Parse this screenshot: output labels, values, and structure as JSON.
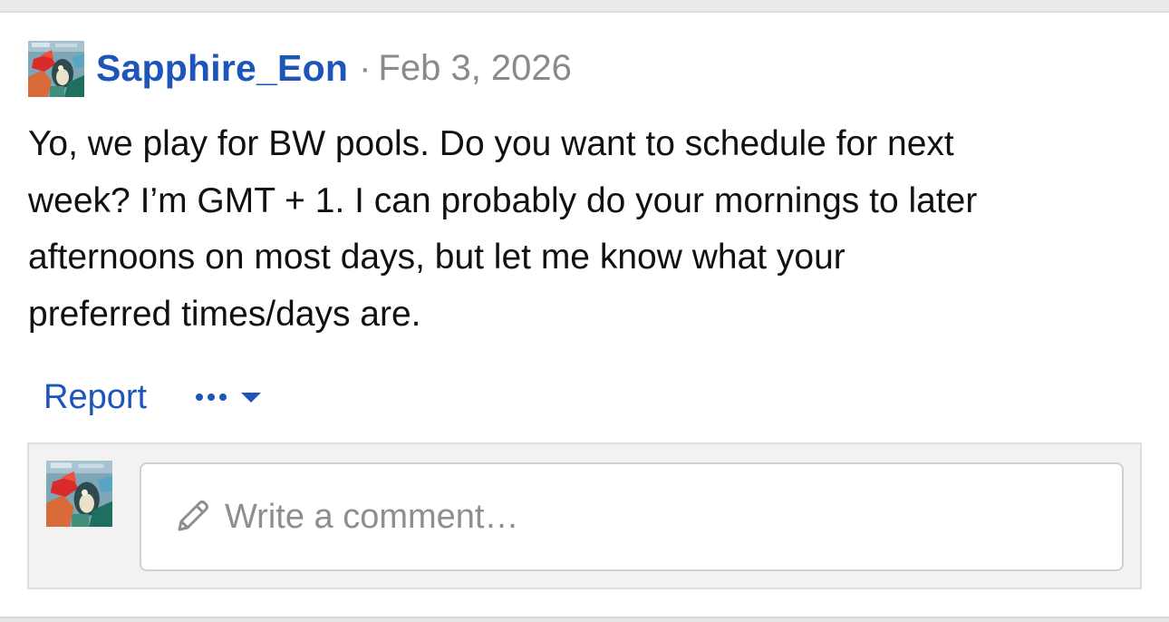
{
  "post": {
    "author": "Sapphire_Eon",
    "separator": "·",
    "date": "Feb 3, 2026",
    "avatar_icon": "pokemon-avatar-icon",
    "body_lines": [
      "Yo, we play for BW pools. Do you want to schedule for next",
      "week? I’m GMT + 1. I can probably do your mornings to later",
      "afternoons on most days, but let me know what your",
      "preferred times/days are."
    ]
  },
  "actions": {
    "report_label": "Report",
    "more_icon": "ellipsis-icon",
    "dropdown_icon": "caret-down-icon"
  },
  "comment": {
    "avatar_icon": "pokemon-avatar-icon",
    "edit_icon": "pencil-icon",
    "placeholder": "Write a comment…"
  },
  "colors": {
    "link": "#1d56b8",
    "meta": "#8a8a8a",
    "body_text": "#111111",
    "placeholder": "#8e8e8e",
    "panel": "#f2f2f2",
    "divider": "#ebebeb"
  }
}
